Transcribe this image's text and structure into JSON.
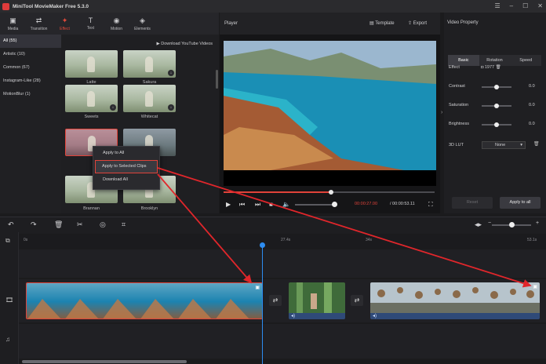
{
  "app": {
    "title": "MiniTool MovieMaker Free 5.3.0"
  },
  "media_toolbar": {
    "tabs": [
      {
        "label": "Media",
        "icon": "folder-icon"
      },
      {
        "label": "Transition",
        "icon": "transition-icon"
      },
      {
        "label": "Effect",
        "icon": "effect-icon",
        "active": true
      },
      {
        "label": "Text",
        "icon": "text-icon"
      },
      {
        "label": "Motion",
        "icon": "motion-icon"
      },
      {
        "label": "Elements",
        "icon": "elements-icon"
      }
    ]
  },
  "categories": [
    {
      "label": "All (55)",
      "active": true
    },
    {
      "label": "Artistic (10)"
    },
    {
      "label": "Common (67)"
    },
    {
      "label": "Instagram-Like (28)"
    },
    {
      "label": "MotionBlur (1)"
    }
  ],
  "effects": {
    "download_link": "Download YouTube Videos",
    "items": [
      {
        "label": "Latte"
      },
      {
        "label": "Sakura"
      },
      {
        "label": "Sweets"
      },
      {
        "label": "Whitecat"
      },
      {
        "label": ""
      },
      {
        "label": ""
      },
      {
        "label": "Brannan"
      },
      {
        "label": "Brooklyn"
      }
    ]
  },
  "context_menu": {
    "items": [
      "Apply to All",
      "Apply to Selected Clips",
      "Download All"
    ]
  },
  "player": {
    "title": "Player",
    "template_label": "Template",
    "export_label": "Export",
    "progress_fraction": 0.51,
    "volume_fraction": 0.9,
    "current_time": "00:00:27.00",
    "total_time": "/ 00:00:53.11"
  },
  "properties": {
    "title": "Video Property",
    "tabs": [
      "Basic",
      "Rotation",
      "Speed"
    ],
    "effect_label": "Effect",
    "effect_value": "1977",
    "contrast_label": "Contrast",
    "contrast_value": "0.0",
    "saturation_label": "Saturation",
    "saturation_value": "0.0",
    "brightness_label": "Brightness",
    "brightness_value": "0.0",
    "lut_label": "3D LUT",
    "lut_value": "None",
    "reset_label": "Reset",
    "apply_all_label": "Apply to all"
  },
  "timeline": {
    "ruler": [
      "0s",
      "27.4s",
      "34s",
      "53.1s"
    ],
    "playhead_time": "27.4s"
  },
  "colors": {
    "accent": "#e0433a",
    "playhead": "#2d8cf0",
    "background": "#1b1b1d"
  }
}
